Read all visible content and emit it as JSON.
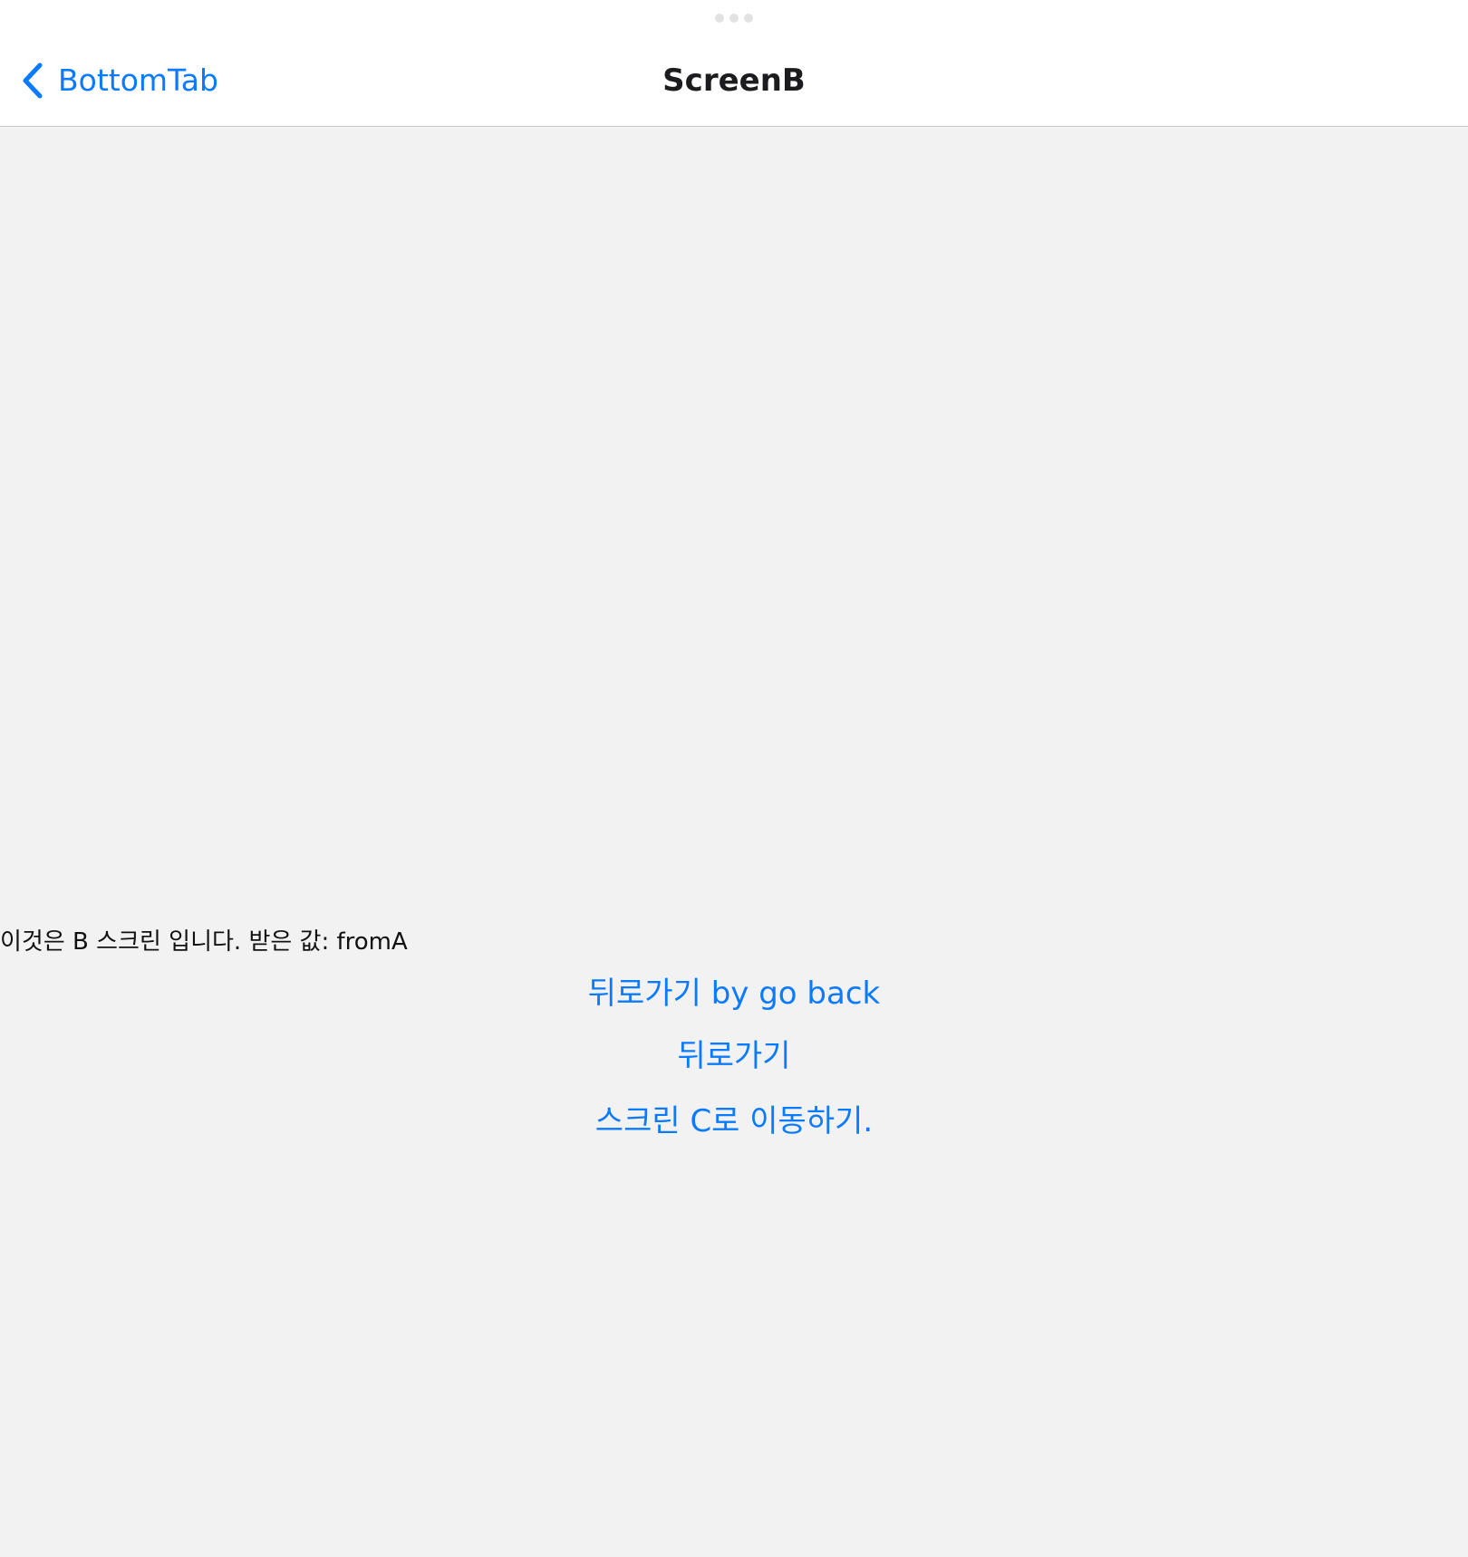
{
  "header": {
    "back_label": "BottomTab",
    "title": "ScreenB",
    "back_icon": "chevron-left-icon",
    "grabber_icon": "more-dots-icon"
  },
  "content": {
    "received_text": "이것은 B 스크린 입니다. 받은 값: fromA",
    "actions": {
      "go_back_by_go_back": "뒤로가기 by go back",
      "go_back": "뒤로가기",
      "go_to_screen_c": "스크린 C로 이동하기."
    }
  },
  "colors": {
    "accent": "#0a7aff",
    "background": "#f2f2f2",
    "header_background": "#ffffff",
    "title_text": "#1c1c1e"
  }
}
